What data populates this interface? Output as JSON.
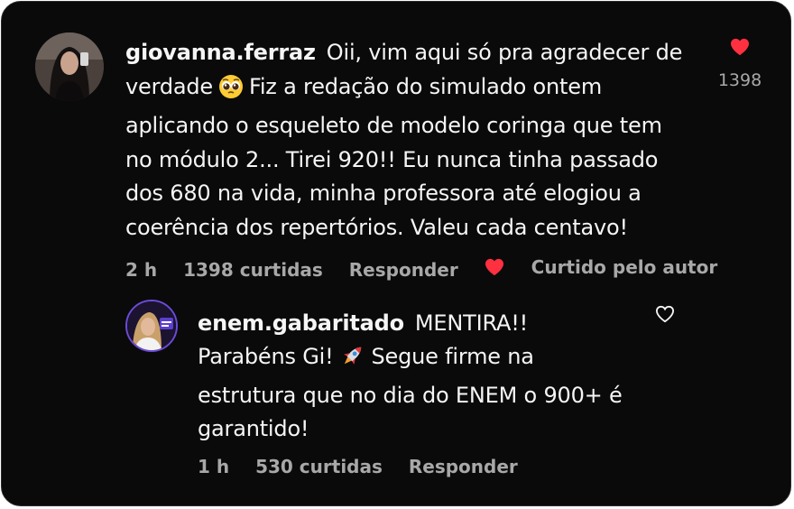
{
  "main_comment": {
    "username": "giovanna.ferraz",
    "text_part1": "Oii, vim aqui só pra agradecer de verdade",
    "emoji": "pleading-face-emoji",
    "text_part2": "Fiz a redação do simulado ontem aplicando o esqueleto de modelo coringa que tem no módulo 2... Tirei 920!! Eu nunca tinha passado dos 680 na vida, minha professora até elogiou a coerência dos repertórios. Valeu cada centavo!",
    "like_count": "1398",
    "liked": true,
    "time": "2 h",
    "likes_label": "1398 curtidas",
    "reply_label": "Responder",
    "creator_liked_label": "Curtido pelo autor"
  },
  "reply": {
    "username": "enem.gabaritado",
    "text_part1": "MENTIRA!! Parabéns Gi!",
    "emoji": "rocket-emoji",
    "text_part2": "Segue firme na estrutura que no dia do ENEM o 900+ é garantido!",
    "time": "1 h",
    "likes_label": "530 curtidas",
    "reply_label": "Responder",
    "liked": false
  },
  "colors": {
    "background": "#0a0a0a",
    "text": "#f5f5f5",
    "muted": "#a8a8a8",
    "heart": "#ff3040"
  }
}
